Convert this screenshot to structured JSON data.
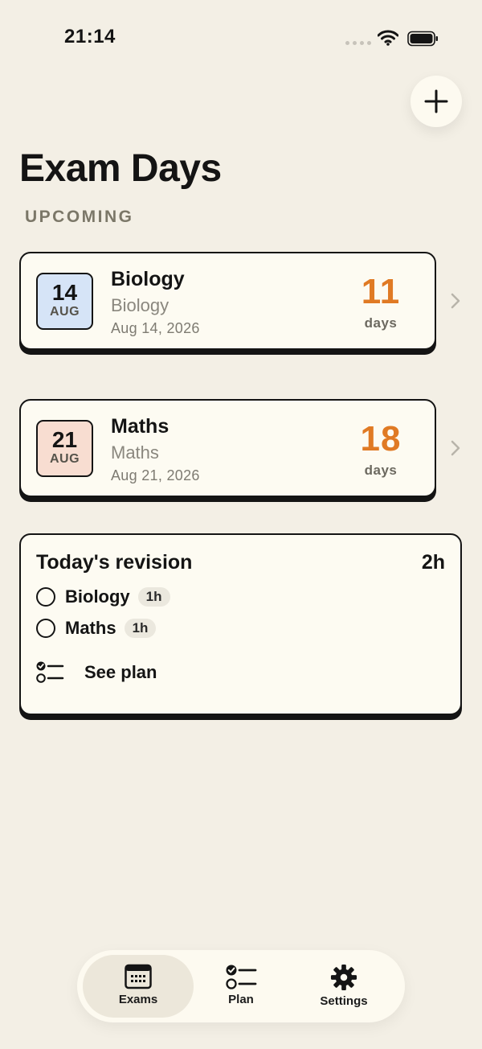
{
  "status": {
    "time": "21:14",
    "icons": [
      "cellular-dots-icon",
      "wifi-icon",
      "battery-icon"
    ]
  },
  "header": {
    "add_icon": "plus-icon",
    "title": "Exam Days"
  },
  "section": {
    "label": "UPCOMING"
  },
  "exams": [
    {
      "day": "14",
      "month": "AUG",
      "name": "Biology",
      "subject": "Biology",
      "date": "Aug 14, 2026",
      "count": "11",
      "unit": "days",
      "badge_color": "#d6e4f7"
    },
    {
      "day": "21",
      "month": "AUG",
      "name": "Maths",
      "subject": "Maths",
      "date": "Aug 21, 2026",
      "count": "18",
      "unit": "days",
      "badge_color": "#f8ddd1"
    }
  ],
  "revision": {
    "title": "Today's revision",
    "total": "2h",
    "items": [
      {
        "subject": "Biology",
        "duration": "1h"
      },
      {
        "subject": "Maths",
        "duration": "1h"
      }
    ],
    "see_plan": "See plan"
  },
  "tabs": [
    {
      "label": "Exams",
      "icon": "calendar-icon",
      "active": true
    },
    {
      "label": "Plan",
      "icon": "checklist-icon",
      "active": false
    },
    {
      "label": "Settings",
      "icon": "gear-icon",
      "active": false
    }
  ],
  "colors": {
    "background": "#f3efe5",
    "card": "#fdfbf2",
    "accent": "#e07a24",
    "ink": "#141414"
  }
}
